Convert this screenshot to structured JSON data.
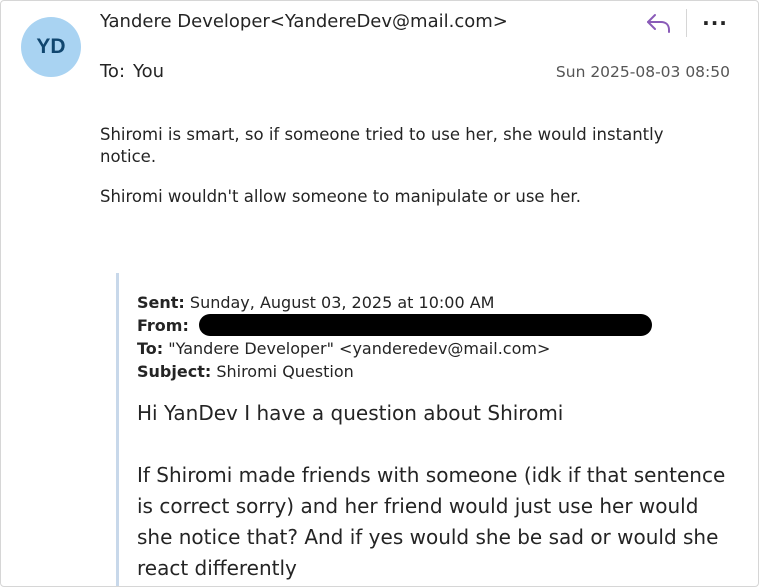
{
  "header": {
    "avatar_initials": "YD",
    "sender": "Yandere Developer<YandereDev@mail.com>",
    "to_label": "To:",
    "to_value": "You",
    "date": "Sun 2025-08-03 08:50",
    "icons": [
      "reply-icon",
      "more-options-icon"
    ],
    "more_label": "···"
  },
  "message": {
    "paragraphs": [
      "Shiromi is smart, so if someone tried to use her, she would instantly notice.",
      "Shiromi wouldn't allow someone to manipulate or use her."
    ]
  },
  "quoted": {
    "sent_label": "Sent:",
    "sent_value": "Sunday, August 03, 2025 at 10:00 AM",
    "from_label": "From:",
    "to_label": "To:",
    "to_value": "\"Yandere Developer\" <yanderedev@mail.com>",
    "subject_label": "Subject:",
    "subject_value": "Shiromi Question",
    "body": [
      "Hi YanDev I have a question about Shiromi",
      "If Shiromi made friends with someone (idk if that sentence is correct sorry) and her friend would just use her would she notice that? And if yes would she be sad or would she react differently"
    ]
  },
  "colors": {
    "avatar_bg": "#a9d3f2",
    "avatar_text": "#10466f",
    "reply_icon": "#8a5bb8",
    "quote_border": "#c8d8ea"
  }
}
